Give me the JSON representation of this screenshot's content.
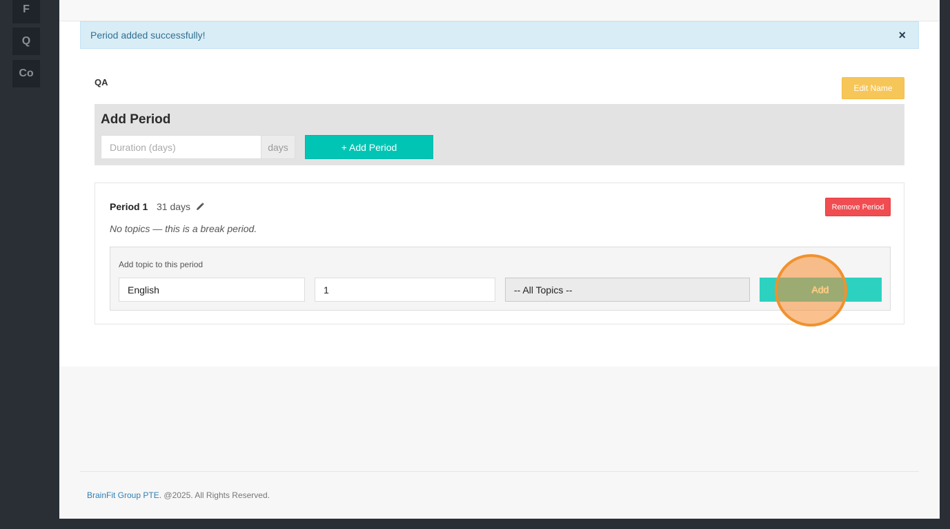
{
  "sidebar": {
    "items": [
      {
        "label": "F"
      },
      {
        "label": "Q"
      },
      {
        "label": "Co"
      }
    ]
  },
  "alert": {
    "message": "Period added successfully!",
    "close": "×"
  },
  "plan": {
    "name": "QA",
    "edit_label": "Edit Name"
  },
  "add_period": {
    "title": "Add Period",
    "duration_placeholder": "Duration (days)",
    "addon": "days",
    "button_label": "+ Add Period"
  },
  "periods": [
    {
      "title": "Period 1",
      "duration": "31 days",
      "remove_label": "Remove Period",
      "empty_note": "No topics — this is a break period.",
      "add_topic": {
        "label": "Add topic to this period",
        "subject_value": "English",
        "level_value": "1",
        "topic_select": "-- All Topics --",
        "add_label": "Add"
      }
    }
  ],
  "footer": {
    "company": "BrainFit Group PTE.",
    "rights": " @2025. All Rights Reserved."
  },
  "icons": {
    "edit": "pencil-icon",
    "close": "close-icon"
  },
  "colors": {
    "accent_teal": "#00c5b5",
    "warning": "#f7c659",
    "danger": "#f04d52",
    "info_bg": "#d9edf7"
  }
}
